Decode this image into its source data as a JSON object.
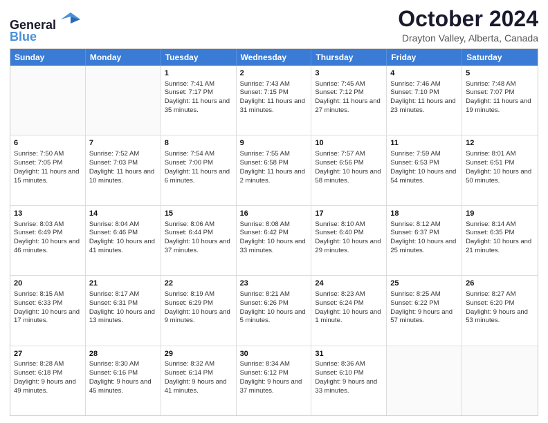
{
  "header": {
    "logo_line1": "General",
    "logo_line2": "Blue",
    "title": "October 2024",
    "subtitle": "Drayton Valley, Alberta, Canada"
  },
  "days_of_week": [
    "Sunday",
    "Monday",
    "Tuesday",
    "Wednesday",
    "Thursday",
    "Friday",
    "Saturday"
  ],
  "weeks": [
    [
      {
        "day": "",
        "sunrise": "",
        "sunset": "",
        "daylight": ""
      },
      {
        "day": "",
        "sunrise": "",
        "sunset": "",
        "daylight": ""
      },
      {
        "day": "1",
        "sunrise": "Sunrise: 7:41 AM",
        "sunset": "Sunset: 7:17 PM",
        "daylight": "Daylight: 11 hours and 35 minutes."
      },
      {
        "day": "2",
        "sunrise": "Sunrise: 7:43 AM",
        "sunset": "Sunset: 7:15 PM",
        "daylight": "Daylight: 11 hours and 31 minutes."
      },
      {
        "day": "3",
        "sunrise": "Sunrise: 7:45 AM",
        "sunset": "Sunset: 7:12 PM",
        "daylight": "Daylight: 11 hours and 27 minutes."
      },
      {
        "day": "4",
        "sunrise": "Sunrise: 7:46 AM",
        "sunset": "Sunset: 7:10 PM",
        "daylight": "Daylight: 11 hours and 23 minutes."
      },
      {
        "day": "5",
        "sunrise": "Sunrise: 7:48 AM",
        "sunset": "Sunset: 7:07 PM",
        "daylight": "Daylight: 11 hours and 19 minutes."
      }
    ],
    [
      {
        "day": "6",
        "sunrise": "Sunrise: 7:50 AM",
        "sunset": "Sunset: 7:05 PM",
        "daylight": "Daylight: 11 hours and 15 minutes."
      },
      {
        "day": "7",
        "sunrise": "Sunrise: 7:52 AM",
        "sunset": "Sunset: 7:03 PM",
        "daylight": "Daylight: 11 hours and 10 minutes."
      },
      {
        "day": "8",
        "sunrise": "Sunrise: 7:54 AM",
        "sunset": "Sunset: 7:00 PM",
        "daylight": "Daylight: 11 hours and 6 minutes."
      },
      {
        "day": "9",
        "sunrise": "Sunrise: 7:55 AM",
        "sunset": "Sunset: 6:58 PM",
        "daylight": "Daylight: 11 hours and 2 minutes."
      },
      {
        "day": "10",
        "sunrise": "Sunrise: 7:57 AM",
        "sunset": "Sunset: 6:56 PM",
        "daylight": "Daylight: 10 hours and 58 minutes."
      },
      {
        "day": "11",
        "sunrise": "Sunrise: 7:59 AM",
        "sunset": "Sunset: 6:53 PM",
        "daylight": "Daylight: 10 hours and 54 minutes."
      },
      {
        "day": "12",
        "sunrise": "Sunrise: 8:01 AM",
        "sunset": "Sunset: 6:51 PM",
        "daylight": "Daylight: 10 hours and 50 minutes."
      }
    ],
    [
      {
        "day": "13",
        "sunrise": "Sunrise: 8:03 AM",
        "sunset": "Sunset: 6:49 PM",
        "daylight": "Daylight: 10 hours and 46 minutes."
      },
      {
        "day": "14",
        "sunrise": "Sunrise: 8:04 AM",
        "sunset": "Sunset: 6:46 PM",
        "daylight": "Daylight: 10 hours and 41 minutes."
      },
      {
        "day": "15",
        "sunrise": "Sunrise: 8:06 AM",
        "sunset": "Sunset: 6:44 PM",
        "daylight": "Daylight: 10 hours and 37 minutes."
      },
      {
        "day": "16",
        "sunrise": "Sunrise: 8:08 AM",
        "sunset": "Sunset: 6:42 PM",
        "daylight": "Daylight: 10 hours and 33 minutes."
      },
      {
        "day": "17",
        "sunrise": "Sunrise: 8:10 AM",
        "sunset": "Sunset: 6:40 PM",
        "daylight": "Daylight: 10 hours and 29 minutes."
      },
      {
        "day": "18",
        "sunrise": "Sunrise: 8:12 AM",
        "sunset": "Sunset: 6:37 PM",
        "daylight": "Daylight: 10 hours and 25 minutes."
      },
      {
        "day": "19",
        "sunrise": "Sunrise: 8:14 AM",
        "sunset": "Sunset: 6:35 PM",
        "daylight": "Daylight: 10 hours and 21 minutes."
      }
    ],
    [
      {
        "day": "20",
        "sunrise": "Sunrise: 8:15 AM",
        "sunset": "Sunset: 6:33 PM",
        "daylight": "Daylight: 10 hours and 17 minutes."
      },
      {
        "day": "21",
        "sunrise": "Sunrise: 8:17 AM",
        "sunset": "Sunset: 6:31 PM",
        "daylight": "Daylight: 10 hours and 13 minutes."
      },
      {
        "day": "22",
        "sunrise": "Sunrise: 8:19 AM",
        "sunset": "Sunset: 6:29 PM",
        "daylight": "Daylight: 10 hours and 9 minutes."
      },
      {
        "day": "23",
        "sunrise": "Sunrise: 8:21 AM",
        "sunset": "Sunset: 6:26 PM",
        "daylight": "Daylight: 10 hours and 5 minutes."
      },
      {
        "day": "24",
        "sunrise": "Sunrise: 8:23 AM",
        "sunset": "Sunset: 6:24 PM",
        "daylight": "Daylight: 10 hours and 1 minute."
      },
      {
        "day": "25",
        "sunrise": "Sunrise: 8:25 AM",
        "sunset": "Sunset: 6:22 PM",
        "daylight": "Daylight: 9 hours and 57 minutes."
      },
      {
        "day": "26",
        "sunrise": "Sunrise: 8:27 AM",
        "sunset": "Sunset: 6:20 PM",
        "daylight": "Daylight: 9 hours and 53 minutes."
      }
    ],
    [
      {
        "day": "27",
        "sunrise": "Sunrise: 8:28 AM",
        "sunset": "Sunset: 6:18 PM",
        "daylight": "Daylight: 9 hours and 49 minutes."
      },
      {
        "day": "28",
        "sunrise": "Sunrise: 8:30 AM",
        "sunset": "Sunset: 6:16 PM",
        "daylight": "Daylight: 9 hours and 45 minutes."
      },
      {
        "day": "29",
        "sunrise": "Sunrise: 8:32 AM",
        "sunset": "Sunset: 6:14 PM",
        "daylight": "Daylight: 9 hours and 41 minutes."
      },
      {
        "day": "30",
        "sunrise": "Sunrise: 8:34 AM",
        "sunset": "Sunset: 6:12 PM",
        "daylight": "Daylight: 9 hours and 37 minutes."
      },
      {
        "day": "31",
        "sunrise": "Sunrise: 8:36 AM",
        "sunset": "Sunset: 6:10 PM",
        "daylight": "Daylight: 9 hours and 33 minutes."
      },
      {
        "day": "",
        "sunrise": "",
        "sunset": "",
        "daylight": ""
      },
      {
        "day": "",
        "sunrise": "",
        "sunset": "",
        "daylight": ""
      }
    ]
  ]
}
